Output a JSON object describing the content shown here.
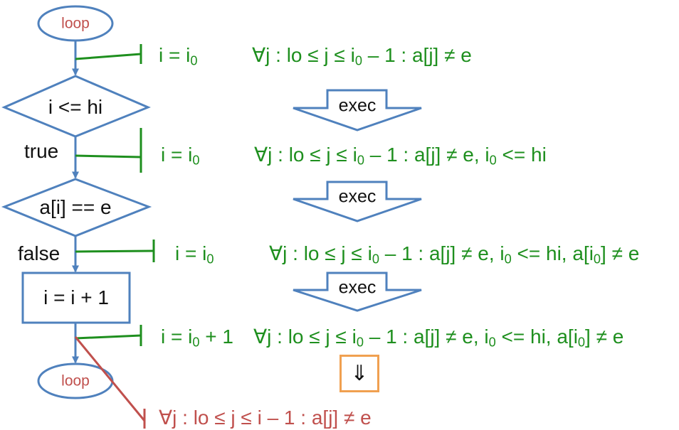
{
  "flow": {
    "loop_start": "loop",
    "condition_1": "i <= hi",
    "branch_true": "true",
    "condition_2": "a[i] == e",
    "branch_false": "false",
    "increment": "i = i + 1",
    "loop_end": "loop"
  },
  "assertions": [
    {
      "assignment_prefix": "i = i",
      "assignment_sub": "0",
      "assignment_suffix": "",
      "condition_segments": [
        {
          "text": "∀j : lo ≤ j ≤ i",
          "sub": "0"
        },
        {
          "text": " – 1 : a[j] ≠ e",
          "sub": ""
        }
      ]
    },
    {
      "assignment_prefix": "i = i",
      "assignment_sub": "0",
      "assignment_suffix": "",
      "condition_segments": [
        {
          "text": "∀j : lo ≤ j ≤ i",
          "sub": "0"
        },
        {
          "text": " – 1 : a[j] ≠ e,  i",
          "sub": "0"
        },
        {
          "text": " <= hi",
          "sub": ""
        }
      ]
    },
    {
      "assignment_prefix": "i = i",
      "assignment_sub": "0",
      "assignment_suffix": "",
      "condition_segments": [
        {
          "text": "∀j : lo ≤ j ≤ i",
          "sub": "0"
        },
        {
          "text": " – 1 : a[j] ≠ e,  i",
          "sub": "0"
        },
        {
          "text": " <= hi,  a[i",
          "sub": "0"
        },
        {
          "text": "] ≠ e",
          "sub": ""
        }
      ]
    },
    {
      "assignment_prefix": "i = i",
      "assignment_sub": "0",
      "assignment_suffix": "  + 1",
      "condition_segments": [
        {
          "text": "∀j : lo ≤ j ≤ i",
          "sub": "0"
        },
        {
          "text": " – 1 : a[j] ≠ e,  i",
          "sub": "0"
        },
        {
          "text": " <= hi,  a[i",
          "sub": "0"
        },
        {
          "text": "] ≠ e",
          "sub": ""
        }
      ]
    }
  ],
  "exec_labels": [
    "exec",
    "exec",
    "exec"
  ],
  "implies_symbol": "⇓",
  "final_assertion": "∀j : lo ≤ j ≤ i – 1 : a[j] ≠ e",
  "colors": {
    "flow_blue": "#4f81bd",
    "assertion_green": "#1e8f1e",
    "loop_red": "#c0504d",
    "implies_orange": "#f0a050"
  }
}
